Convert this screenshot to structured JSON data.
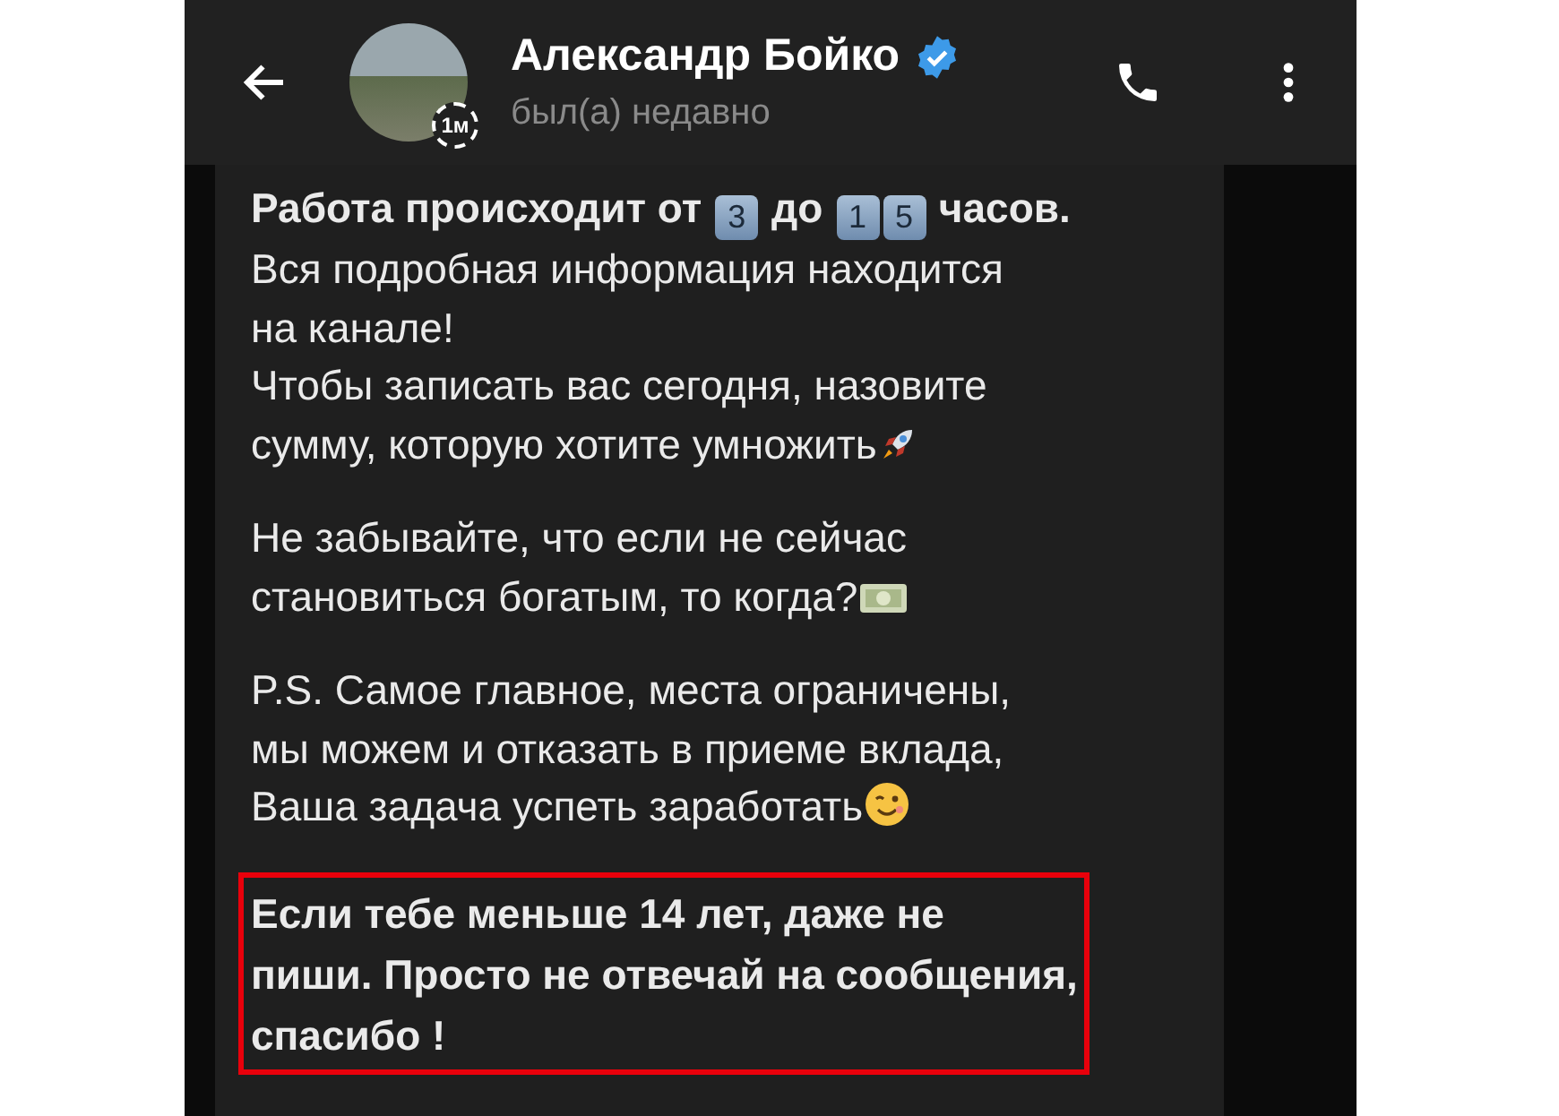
{
  "header": {
    "name": "Александр Бойко",
    "verified": true,
    "status": "был(а) недавно",
    "story_badge": "1м"
  },
  "message": {
    "paragraphs": [
      {
        "highlighted": false,
        "lines": [
          [
            {
              "kind": "bold",
              "text": "Работа происходит от "
            },
            {
              "kind": "keycap",
              "text": "3"
            },
            {
              "kind": "bold",
              "text": " до "
            },
            {
              "kind": "keycap",
              "text": "1"
            },
            {
              "kind": "keycap",
              "text": "5"
            },
            {
              "kind": "bold",
              "text": " часов."
            }
          ],
          [
            {
              "kind": "text",
              "text": "Вся подробная информация находится"
            }
          ],
          [
            {
              "kind": "text",
              "text": "на канале!"
            }
          ],
          [
            {
              "kind": "text",
              "text": "Чтобы записать вас сегодня, назовите"
            }
          ],
          [
            {
              "kind": "text",
              "text": "сумму, которую хотите умножить"
            },
            {
              "kind": "rocket"
            }
          ]
        ]
      },
      {
        "highlighted": false,
        "lines": [
          [
            {
              "kind": "text",
              "text": "Не забывайте, что если не сейчас"
            }
          ],
          [
            {
              "kind": "text",
              "text": "становиться богатым, то когда?"
            },
            {
              "kind": "money"
            }
          ]
        ]
      },
      {
        "highlighted": false,
        "lines": [
          [
            {
              "kind": "text",
              "text": "P.S. Самое главное, места ограничены,"
            }
          ],
          [
            {
              "kind": "text",
              "text": "мы можем и отказать в приеме вклада,"
            }
          ],
          [
            {
              "kind": "text",
              "text": "Ваша задача успеть заработать"
            },
            {
              "kind": "wink"
            }
          ]
        ]
      },
      {
        "highlighted": true,
        "lines": [
          [
            {
              "kind": "bold",
              "text": " Если тебе меньше 14 лет, даже не"
            }
          ],
          [
            {
              "kind": "bold",
              "text": "пиши. Просто не отвечай на сообщения,"
            }
          ],
          [
            {
              "kind": "bold",
              "text": "спасибо !"
            }
          ]
        ]
      }
    ]
  }
}
